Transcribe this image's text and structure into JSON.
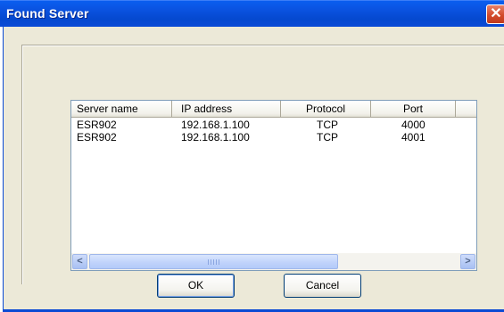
{
  "window": {
    "title": "Found Server",
    "close_glyph": "✕"
  },
  "listview": {
    "columns": [
      "Server name",
      "IP address",
      "Protocol",
      "Port"
    ],
    "rows": [
      [
        "ESR902",
        "192.168.1.100",
        "TCP",
        "4000"
      ],
      [
        "ESR902",
        "192.168.1.100",
        "TCP",
        "4001"
      ]
    ],
    "scroll_left_glyph": "<",
    "scroll_right_glyph": ">"
  },
  "buttons": {
    "ok": "OK",
    "cancel": "Cancel"
  }
}
